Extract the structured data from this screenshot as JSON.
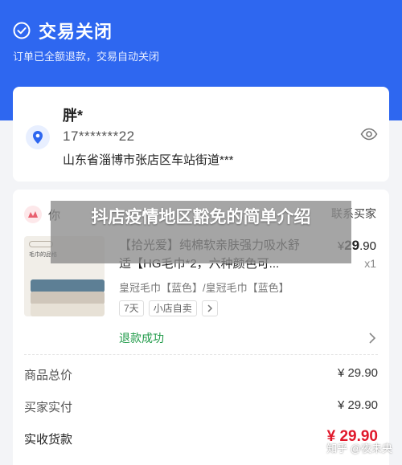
{
  "header": {
    "status_title": "交易关闭",
    "status_subtitle": "订单已全额退款，交易自动关闭",
    "bg_color": "#2e67f0"
  },
  "address": {
    "name": "胖*",
    "phone": "17*******22",
    "line": "山东省淄博市张店区车站街道***"
  },
  "shop": {
    "name": "你",
    "contact_label": "联系买家"
  },
  "product": {
    "title": "【拾光爱】纯棉软亲肤强力吸水舒适【HG毛巾*2，六种颜色可...",
    "spec": "皇冠毛巾【蓝色】/皇冠毛巾【蓝色】",
    "price_symbol": "¥",
    "price_int": "29",
    "price_dec": ".90",
    "quantity": "x1",
    "image_label": "毛巾的品格",
    "tags": [
      "7天",
      "小店自卖"
    ]
  },
  "refund": {
    "status": "退款成功",
    "color": "#1f9a48"
  },
  "summary": [
    {
      "label": "商品总价",
      "value": "¥ 29.90"
    },
    {
      "label": "买家实付",
      "value": "¥ 29.90"
    },
    {
      "label": "实收货款",
      "value": "¥ 29.90"
    }
  ],
  "overlay": {
    "title": "抖店疫情地区豁免的简单介绍"
  },
  "watermark": "知乎 @夜未央"
}
